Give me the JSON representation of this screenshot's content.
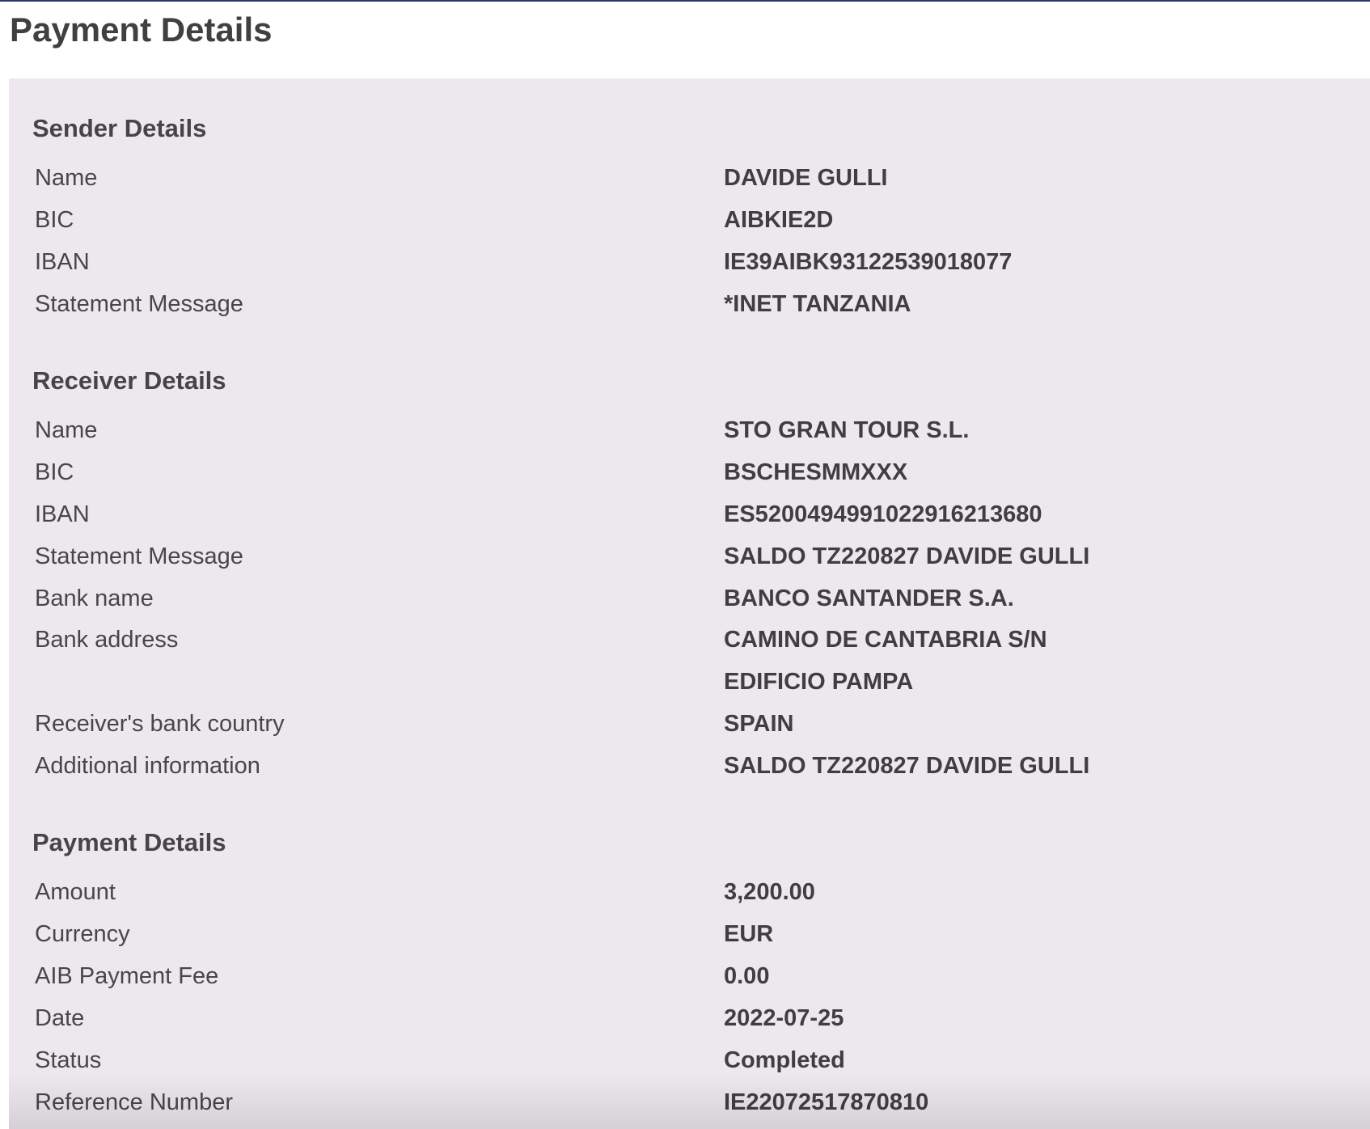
{
  "page": {
    "title": "Payment Details"
  },
  "sender": {
    "title": "Sender Details",
    "rows": [
      {
        "label": "Name",
        "value": "DAVIDE GULLI"
      },
      {
        "label": "BIC",
        "value": "AIBKIE2D"
      },
      {
        "label": "IBAN",
        "value": "IE39AIBK93122539018077"
      },
      {
        "label": "Statement Message",
        "value": "*INET TANZANIA"
      }
    ]
  },
  "receiver": {
    "title": "Receiver Details",
    "rows": [
      {
        "label": "Name",
        "value": "STO GRAN TOUR S.L."
      },
      {
        "label": "BIC",
        "value": "BSCHESMMXXX"
      },
      {
        "label": "IBAN",
        "value": "ES5200494991022916213680"
      },
      {
        "label": "Statement Message",
        "value": "SALDO TZ220827 DAVIDE GULLI"
      },
      {
        "label": "Bank name",
        "value": "BANCO SANTANDER S.A."
      },
      {
        "label": "Bank address",
        "value": "CAMINO DE CANTABRIA S/N"
      },
      {
        "label": "",
        "value": "EDIFICIO PAMPA"
      },
      {
        "label": "Receiver's bank country",
        "value": "SPAIN"
      },
      {
        "label": "Additional information",
        "value": "SALDO TZ220827 DAVIDE GULLI"
      }
    ]
  },
  "payment": {
    "title": "Payment Details",
    "rows": [
      {
        "label": "Amount",
        "value": "3,200.00"
      },
      {
        "label": "Currency",
        "value": "EUR"
      },
      {
        "label": "AIB Payment Fee",
        "value": "0.00"
      },
      {
        "label": "Date",
        "value": "2022-07-25"
      },
      {
        "label": "Status",
        "value": "Completed"
      },
      {
        "label": "Reference Number",
        "value": "IE22072517870810"
      }
    ]
  }
}
